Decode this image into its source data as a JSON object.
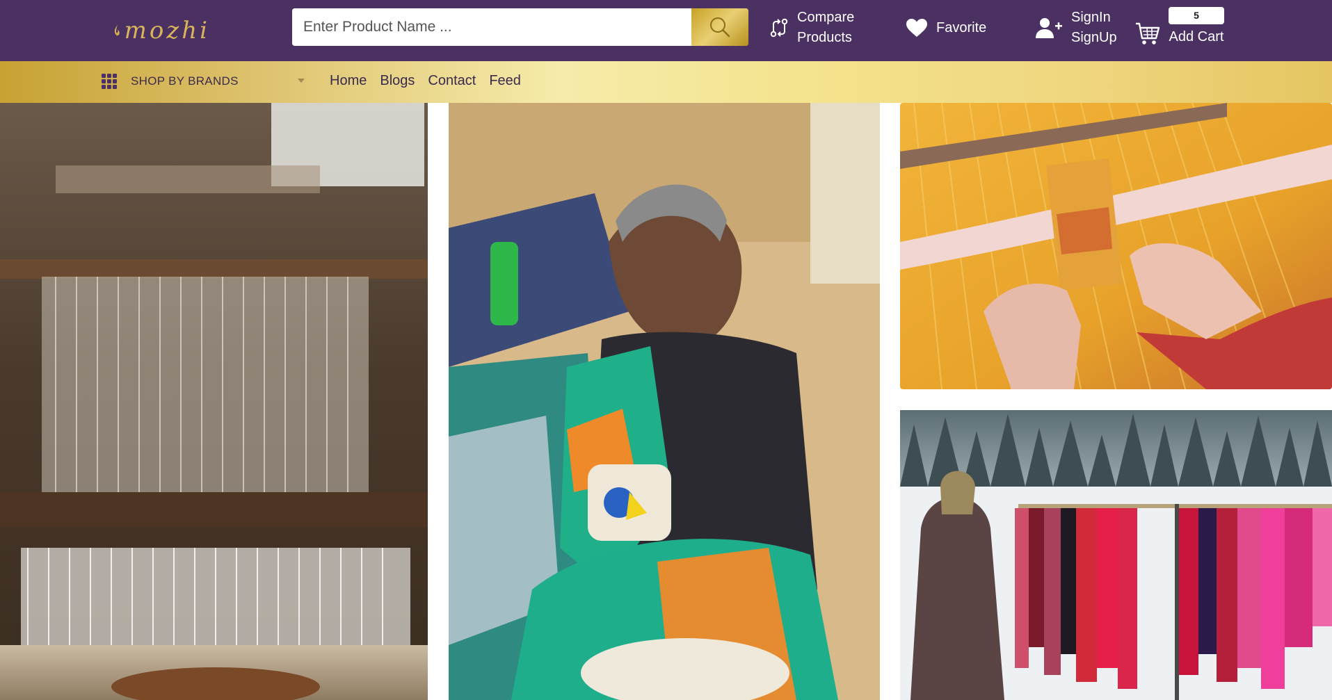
{
  "brand": {
    "logo_text": "mozhi",
    "logo_icon": "flame-leaf-icon"
  },
  "search": {
    "placeholder": "Enter Product Name ...",
    "value": "",
    "button_icon": "search-icon"
  },
  "header_actions": {
    "compare": {
      "line1": "Compare",
      "line2": "Products",
      "icon": "compare-arrows-icon"
    },
    "favorite": {
      "label": "Favorite",
      "icon": "heart-icon"
    },
    "account": {
      "line1": "SignIn",
      "line2": "SignUp",
      "icon": "user-plus-icon"
    },
    "cart": {
      "count": "5",
      "label": "Add Cart",
      "icon": "cart-icon"
    }
  },
  "navbar": {
    "brands_label": "SHOP BY BRANDS",
    "brands_icon": "grid-icon",
    "links": [
      "Home",
      "Blogs",
      "Contact",
      "Feed"
    ]
  },
  "colors": {
    "header_bg": "#4a3162",
    "gold_accent": "#e8cf73",
    "nav_text": "#3a2a4d"
  },
  "gallery": [
    {
      "subject": "handloom-weaving-threads"
    },
    {
      "subject": "elderly-woman-painting-pottery"
    },
    {
      "subject": "hands-weaving-yellow-fabric"
    },
    {
      "subject": "man-with-shawls-in-snow"
    }
  ]
}
